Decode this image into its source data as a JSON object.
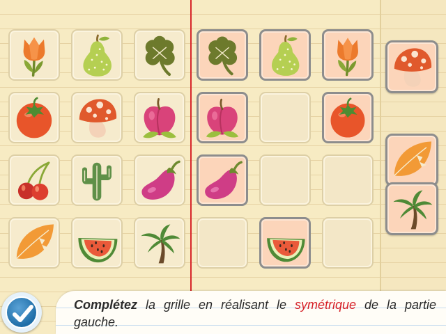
{
  "instruction": {
    "part1": "Complétez",
    "part2": "la grille en réalisant le",
    "part3": "symétrique",
    "part4": "de la partie gauche."
  },
  "grid": {
    "left": [
      [
        "tulip",
        "pear",
        "clover"
      ],
      [
        "tomato",
        "mushroom",
        "peach"
      ],
      [
        "cherry",
        "cactus",
        "eggplant"
      ],
      [
        "leaf",
        "watermelon",
        "palm"
      ]
    ],
    "right": [
      [
        "clover",
        "pear",
        "tulip"
      ],
      [
        "peach",
        "",
        "tomato"
      ],
      [
        "eggplant",
        "",
        ""
      ],
      [
        "",
        "watermelon",
        ""
      ]
    ]
  },
  "tray": [
    "mushroom",
    "leaf",
    "palm"
  ],
  "colors": {
    "paper": "#f7ebc3",
    "margin_line": "#d7262a",
    "filled_cell": "#fcd5ba",
    "highlight_text": "#d61f26",
    "validate_button": "#1f6ea8"
  },
  "validate_icon": "checkmark-icon"
}
